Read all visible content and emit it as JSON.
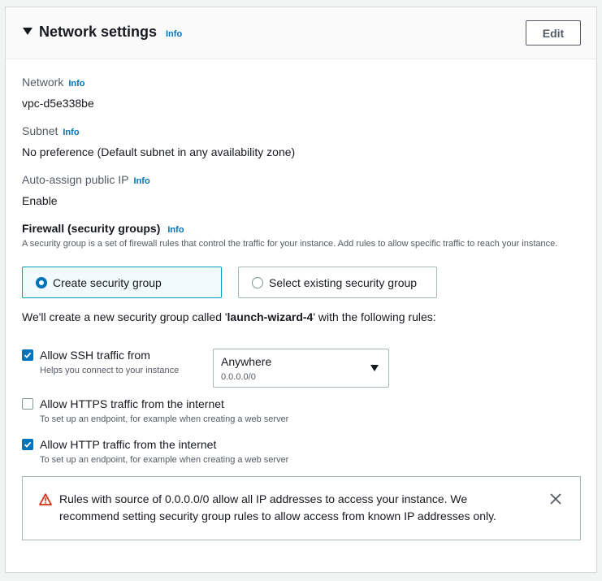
{
  "header": {
    "title": "Network settings",
    "info": "Info",
    "edit_label": "Edit"
  },
  "network": {
    "label": "Network",
    "info": "Info",
    "value": "vpc-d5e338be"
  },
  "subnet": {
    "label": "Subnet",
    "info": "Info",
    "value": "No preference (Default subnet in any availability zone)"
  },
  "auto_ip": {
    "label": "Auto-assign public IP",
    "info": "Info",
    "value": "Enable"
  },
  "firewall": {
    "label": "Firewall (security groups)",
    "info": "Info",
    "description": "A security group is a set of firewall rules that control the traffic for your instance. Add rules to allow specific traffic to reach your instance.",
    "options": [
      {
        "label": "Create security group",
        "selected": true
      },
      {
        "label": "Select existing security group",
        "selected": false
      }
    ],
    "create_note_prefix": "We'll create a new security group called '",
    "create_note_name": "launch-wizard-4",
    "create_note_suffix": "' with the following rules:"
  },
  "rules": [
    {
      "label": "Allow SSH traffic from",
      "help": "Helps you connect to your instance",
      "checked": true
    },
    {
      "label": "Allow HTTPS traffic from the internet",
      "help": "To set up an endpoint, for example when creating a web server",
      "checked": false
    },
    {
      "label": "Allow HTTP traffic from the internet",
      "help": "To set up an endpoint, for example when creating a web server",
      "checked": true
    }
  ],
  "ssh_source": {
    "selected": "Anywhere",
    "cidr": "0.0.0.0/0"
  },
  "alert": {
    "text": "Rules with source of 0.0.0.0/0 allow all IP addresses to access your instance. We recommend setting security group rules to allow access from known IP addresses only."
  },
  "colors": {
    "accent": "#0073bb",
    "warning": "#d13212",
    "selected_tile_bg": "#f1faff"
  },
  "icons": {
    "collapse": "caret-down-icon",
    "warning": "warning-icon",
    "dismiss": "close-icon",
    "checked": "checkmark-icon",
    "dropdown": "chevron-down-icon"
  }
}
